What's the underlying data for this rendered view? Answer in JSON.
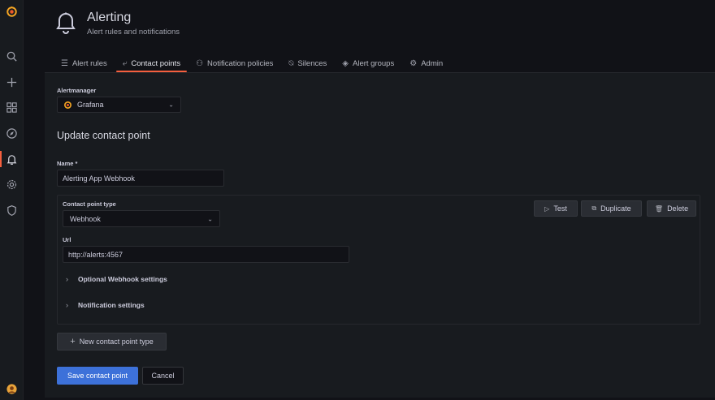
{
  "header": {
    "title": "Alerting",
    "subtitle": "Alert rules and notifications"
  },
  "tabs": [
    {
      "label": "Alert rules",
      "icon": "list-icon",
      "active": false
    },
    {
      "label": "Contact points",
      "icon": "comment-alt-share-icon",
      "active": true
    },
    {
      "label": "Notification policies",
      "icon": "sitemap-icon",
      "active": false
    },
    {
      "label": "Silences",
      "icon": "bell-slash-icon",
      "active": false
    },
    {
      "label": "Alert groups",
      "icon": "layer-group-icon",
      "active": false
    },
    {
      "label": "Admin",
      "icon": "cog-icon",
      "active": false
    }
  ],
  "alertmanager": {
    "label": "Alertmanager",
    "value": "Grafana"
  },
  "form": {
    "heading": "Update contact point",
    "name_label": "Name *",
    "name_value": "Alerting App Webhook",
    "type_label": "Contact point type",
    "type_value": "Webhook",
    "url_label": "Url",
    "url_value": "http://alerts:4567",
    "optional_settings": "Optional Webhook settings",
    "notification_settings": "Notification settings",
    "test_label": "Test",
    "duplicate_label": "Duplicate",
    "delete_label": "Delete",
    "new_type_label": "New contact point type",
    "save_label": "Save contact point",
    "cancel_label": "Cancel"
  },
  "colors": {
    "brand": "#f55f3e",
    "primary": "#3d71d9",
    "background": "#111217",
    "panel": "#181b1f"
  }
}
